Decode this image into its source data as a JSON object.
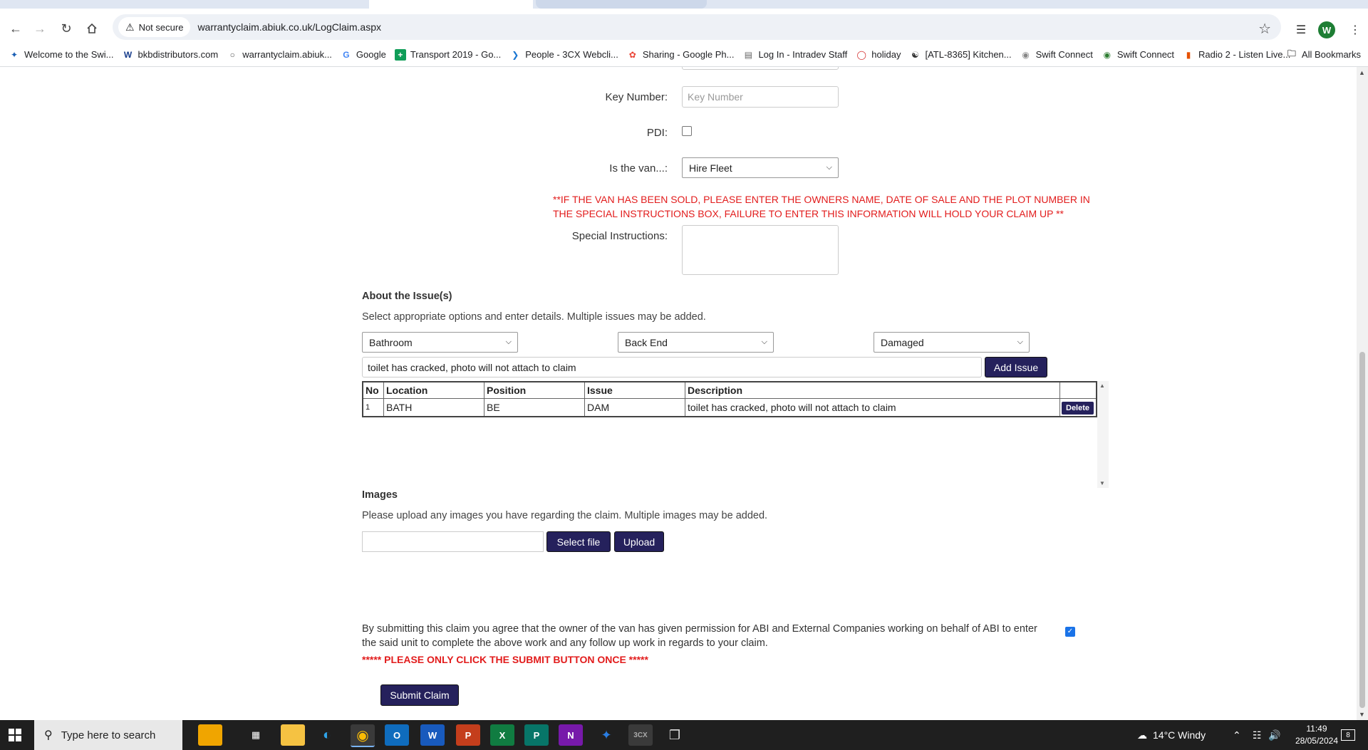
{
  "browser": {
    "security_label": "Not secure",
    "url": "warrantyclaim.abiuk.co.uk/LogClaim.aspx",
    "profile_initial": "W",
    "bookmarks": [
      {
        "label": "Welcome to the Swi...",
        "icon": "swift-logo-icon"
      },
      {
        "label": "bkbdistributors.com",
        "icon": "bkb-logo-icon"
      },
      {
        "label": "warrantyclaim.abiuk...",
        "icon": "globe-icon"
      },
      {
        "label": "Google",
        "icon": "google-icon"
      },
      {
        "label": "Transport 2019 - Go...",
        "icon": "sheets-icon"
      },
      {
        "label": "People - 3CX Webcli...",
        "icon": "3cx-icon"
      },
      {
        "label": "Sharing - Google Ph...",
        "icon": "photos-icon"
      },
      {
        "label": "Log In - Intradev Staff",
        "icon": "doc-icon"
      },
      {
        "label": "holiday",
        "icon": "holiday-icon"
      },
      {
        "label": "[ATL-8365] Kitchen...",
        "icon": "jira-icon"
      },
      {
        "label": "Swift Connect",
        "icon": "swift-connect-icon"
      },
      {
        "label": "Swift Connect",
        "icon": "swift-connect-icon"
      },
      {
        "label": "Radio 2 - Listen Live...",
        "icon": "radio-icon"
      }
    ],
    "all_bookmarks_label": "All Bookmarks"
  },
  "form": {
    "key_number_label": "Key Number:",
    "key_number_placeholder": "Key Number",
    "pdi_label": "PDI:",
    "is_van_label": "Is the van...:",
    "is_van_value": "Hire Fleet",
    "sold_warning": "**IF THE VAN HAS BEEN SOLD, PLEASE ENTER THE OWNERS NAME, DATE OF SALE AND THE PLOT NUMBER IN THE SPECIAL INSTRUCTIONS BOX, FAILURE TO ENTER THIS INFORMATION WILL HOLD YOUR CLAIM UP **",
    "special_instructions_label": "Special Instructions:"
  },
  "issues": {
    "heading": "About the Issue(s)",
    "intro": "Select appropriate options and enter details. Multiple issues may be added.",
    "location_value": "Bathroom",
    "position_value": "Back End",
    "issue_value": "Damaged",
    "description_value": "toilet has cracked, photo will not attach to claim",
    "add_button": "Add Issue",
    "columns": [
      "No",
      "Location",
      "Position",
      "Issue",
      "Description",
      ""
    ],
    "rows": [
      {
        "no": "1",
        "location": "BATH",
        "position": "BE",
        "issue": "DAM",
        "description": "toilet has cracked, photo will not attach to claim",
        "action": "Delete"
      }
    ]
  },
  "images": {
    "heading": "Images",
    "intro": "Please upload any images you have regarding the claim. Multiple images may be added.",
    "select_button": "Select file",
    "upload_button": "Upload"
  },
  "consent": {
    "text": "By submitting this claim you agree that the owner of the van has given permission for ABI and External Companies working on behalf of ABI to enter the said unit to complete the above work and any follow up work in regards to your claim.",
    "checked": true,
    "warning": "***** PLEASE ONLY CLICK THE SUBMIT BUTTON ONCE *****",
    "submit_button": "Submit Claim"
  },
  "taskbar": {
    "search_placeholder": "Type here to search",
    "weather": "14°C  Windy",
    "time": "11:49",
    "date": "28/05/2024",
    "notification_count": "8"
  },
  "colors": {
    "button_bg": "#25215c",
    "warning_red": "#e21c1c"
  }
}
